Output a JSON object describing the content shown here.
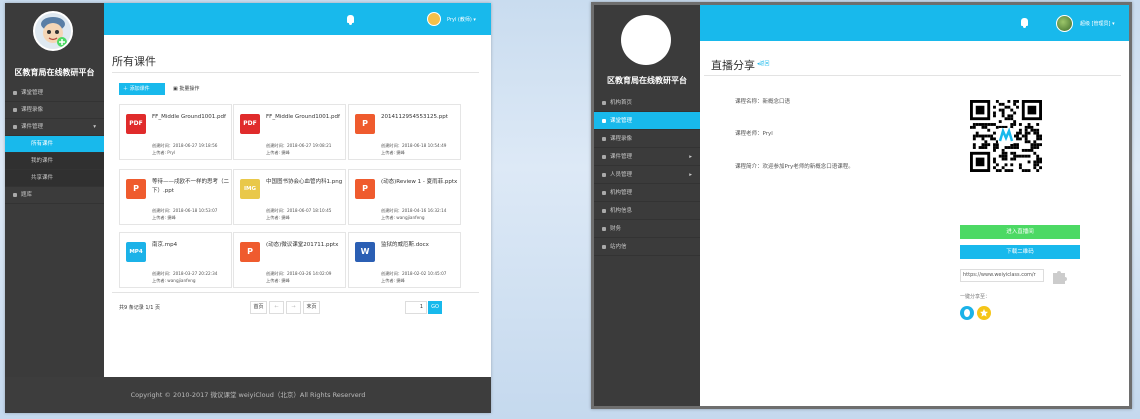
{
  "left": {
    "brand": "区教育局在线教研平台",
    "user_name": "Pryl (教师) ▾",
    "sidebar": [
      {
        "label": "课堂管理"
      },
      {
        "label": "课程录像"
      },
      {
        "label": "课件管理",
        "arrow": "▾"
      },
      {
        "label": "所有课件"
      },
      {
        "label": "我的课件"
      },
      {
        "label": "共享课件"
      },
      {
        "label": "题库"
      }
    ],
    "page_title": "所有课件",
    "add_label": "添加课件",
    "batch_label": "批量操作",
    "files": [
      {
        "name": "FF_Middle Ground1001.pdf",
        "type": "PDF",
        "color": "#e02b2b",
        "created": "创建时间：2018-06-27 19:18:56",
        "uploader": "上传者: Pryl"
      },
      {
        "name": "FF_Middle Ground1001.pdf",
        "type": "PDF",
        "color": "#e02b2b",
        "created": "创建时间：2018-06-27 19:08:21",
        "uploader": "上传者: 捷峰"
      },
      {
        "name": "2014112954553125.ppt",
        "type": "P",
        "color": "#ef5b2e",
        "created": "创建时间：2018-06-18 10:54:49",
        "uploader": "上传者: 捷峰"
      },
      {
        "name": "等待——戌欧不一样的思考（二下）.ppt",
        "type": "P",
        "color": "#ef5b2e",
        "created": "创建时间：2018-06-18 10:53:07",
        "uploader": "上传者: 捷峰"
      },
      {
        "name": "中国图书协会心血管内科1.png",
        "type": "IMG",
        "color": "#e9c84a",
        "created": "创建时间：2018-06-07 18:10:45",
        "uploader": "上传者: 捷峰"
      },
      {
        "name": "(动态)Review 1 - 夏雨菲.pptx",
        "type": "P",
        "color": "#ef5b2e",
        "created": "创建时间：2018-04-16 16:32:14",
        "uploader": "上传者: wangjianfeng"
      },
      {
        "name": "南京.mp4",
        "type": "MP4",
        "color": "#1bb2e8",
        "created": "创建时间：2018-03-27 20:22:34",
        "uploader": "上传者: wangjianfeng"
      },
      {
        "name": "(动态)微议课堂201711.pptx",
        "type": "P",
        "color": "#ef5b2e",
        "created": "创建时间：2018-03-26 14:02:09",
        "uploader": "上传者: 捷峰"
      },
      {
        "name": "监狱的威厄斯.docx",
        "type": "W",
        "color": "#2b5fb4",
        "created": "创建时间：2018-02-02 10:45:07",
        "uploader": "上传者: 捷峰"
      }
    ],
    "pager": {
      "summary": "共9 条记录 1/1 页",
      "first": "首页",
      "prev": "←",
      "next": "→",
      "last": "末页",
      "page_input": "1",
      "go": "GO"
    },
    "footer": "Copyright © 2010-2017 微议课堂 weiyiCloud（北京）All Rights Reserverd"
  },
  "right": {
    "brand": "区教育局在线教研平台",
    "user_name": "超级 [管理员] ▾",
    "sidebar": [
      {
        "label": "机构首页"
      },
      {
        "label": "课堂管理"
      },
      {
        "label": "课程录像"
      },
      {
        "label": "课件管理",
        "arrow": "▸"
      },
      {
        "label": "人员管理",
        "arrow": "▸"
      },
      {
        "label": "机构管理"
      },
      {
        "label": "机构信息"
      },
      {
        "label": "财务"
      },
      {
        "label": "站内信"
      }
    ],
    "page_title": "直播分享",
    "back_label": "返回",
    "course_name": "课程名称：新概念口语",
    "teacher": "课程老师：Pryl",
    "intro": "课程简介：欢迎参加Pry老师的新概念口语课程。",
    "enter_live": "进入直播间",
    "download_qr": "下载二维码",
    "share_url": "https://www.weiyiclass.com/r",
    "share_label": "一键分享至：",
    "colors": {
      "accent": "#18b9ec",
      "green": "#4cd964",
      "qq": "#1bb2e8",
      "qzone": "#f5c518"
    }
  }
}
